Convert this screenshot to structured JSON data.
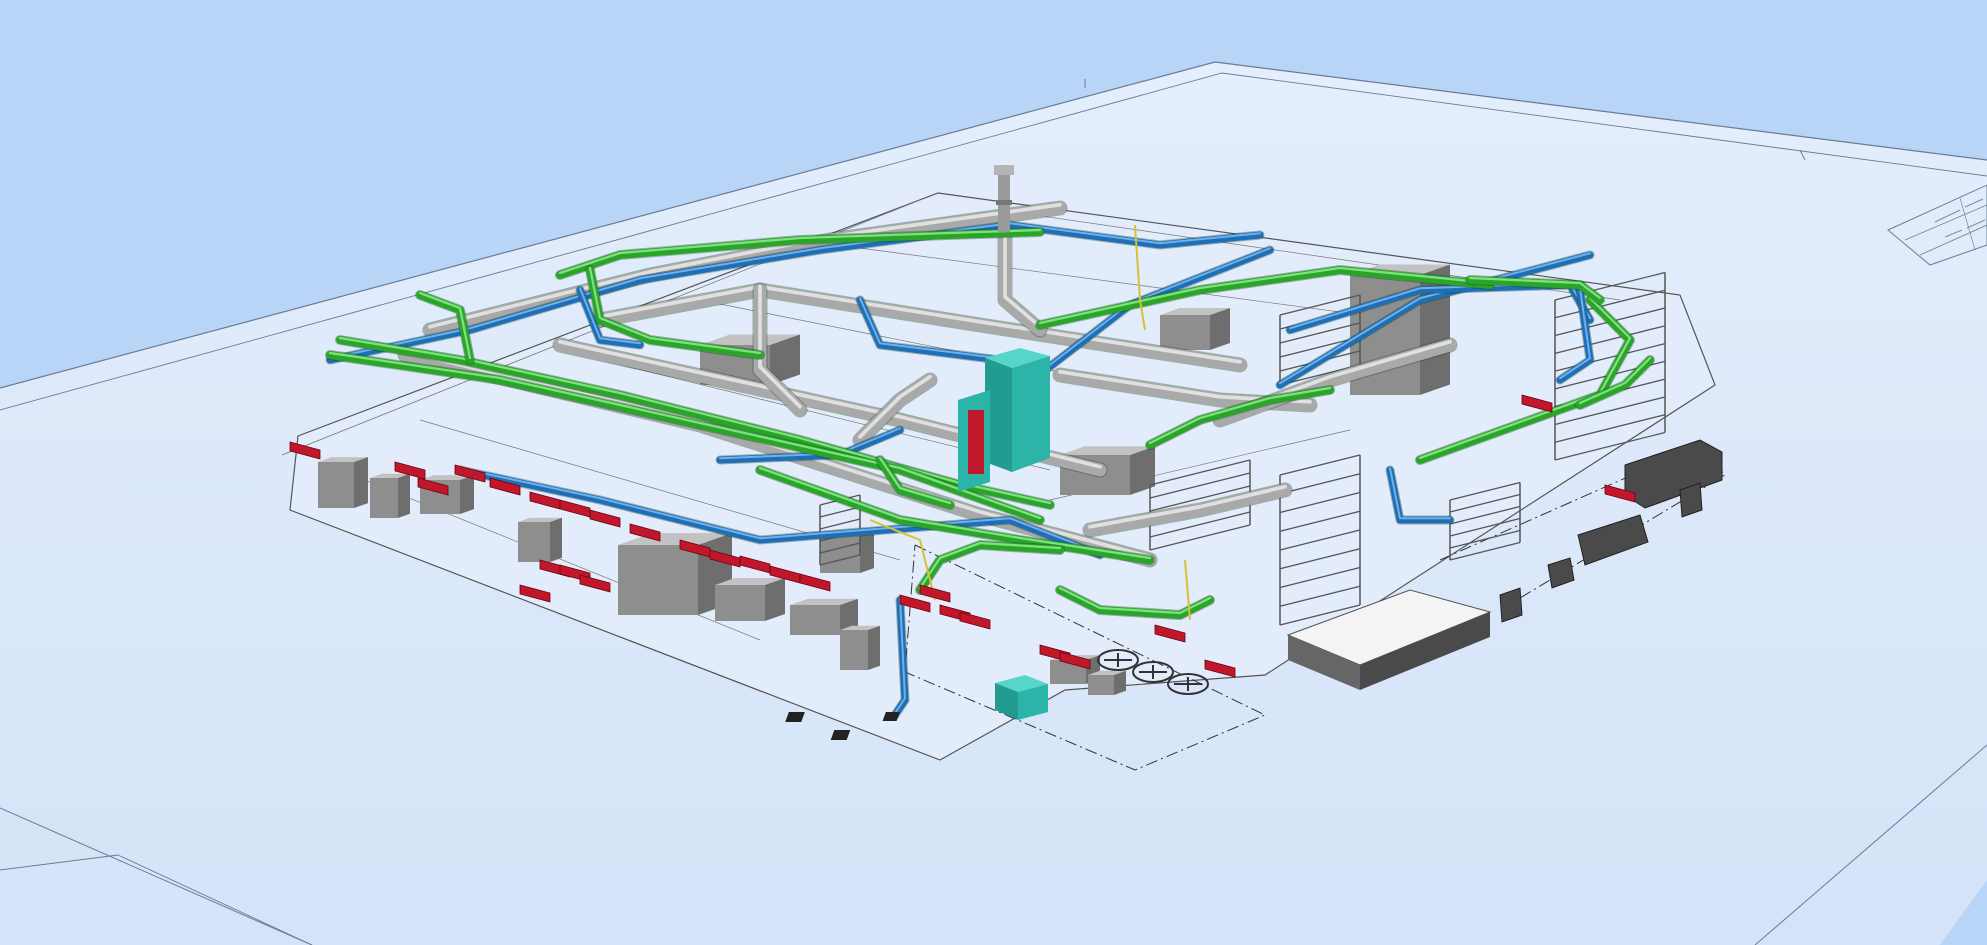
{
  "viewer": {
    "view_mode": "3D perspective",
    "background_color": "#b8d4f6",
    "sheet_color": "#dde9fb",
    "sheet_edge_color": "#6a7c95"
  },
  "model": {
    "colors": {
      "supply_pipe": "#2aa52a",
      "supply_pipe_highlight": "#7ee07e",
      "chilled_pipe": "#1f6fb8",
      "chilled_pipe_highlight": "#6fb0ea",
      "duct": "#a9a9a9",
      "duct_highlight": "#e0e0e0",
      "equipment": "#8e8e8e",
      "equipment_dark": "#4a4a4a",
      "air_handler": "#2bb5a8",
      "fire_damper": "#c0172b",
      "cable_tray": "#d4c33a",
      "rack": "#9a9a9a"
    },
    "icons": [
      "exhaust-fan-icon",
      "roof-fan-icon",
      "floor-drain-icon"
    ]
  },
  "title_block": {
    "visible": true
  }
}
